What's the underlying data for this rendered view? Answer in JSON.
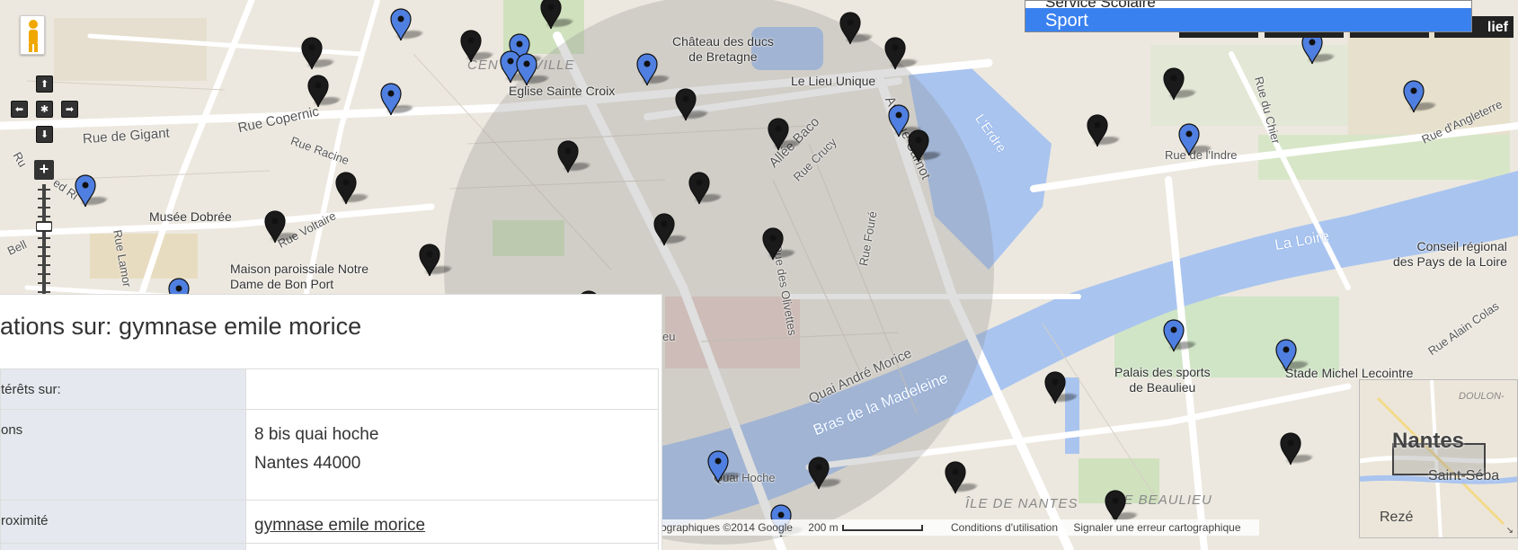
{
  "map": {
    "places": [
      {
        "id": "chateau",
        "text": "Château des ducs\nde Bretagne"
      },
      {
        "id": "lieu-unique",
        "text": "Le Lieu Unique"
      },
      {
        "id": "eglise",
        "text": "Eglise Sainte Croix"
      },
      {
        "id": "musee",
        "text": "Musée Dobrée"
      },
      {
        "id": "maison",
        "text": "Maison paroissiale Notre\nDame de Bon Port"
      },
      {
        "id": "palais",
        "text": "Palais des sports\nde Beaulieu"
      },
      {
        "id": "stade",
        "text": "Stade Michel Lecointre"
      },
      {
        "id": "conseil",
        "text": "Conseil régional\ndes Pays de la Loire"
      }
    ],
    "streets": {
      "gigant": "Rue de Gigant",
      "copernic": "Rue Copernic",
      "racine": "Rue Racine",
      "voltaire": "Rue Voltaire",
      "lamoriciere": "Rue Lamor",
      "bell": "Bell",
      "allee_baco": "Allée Baco",
      "rue_crucy": "Rue Crucy",
      "avenue_carnot": "Avenue Carnot",
      "rue_foure": "Rue Fouré",
      "olivettes": "Rue des Olivettes",
      "quai_andre_morice": "Quai André Morice",
      "quai_hoche": "Quai Hoche",
      "rue_indre": "Rue de l'Indre",
      "rue_chier": "Rue du Chier",
      "rue_angleterre": "Rue d'Angleterre",
      "rue_alain_colas": "Rue Alain Colas",
      "ru": "Ru",
      "ed_ri": "ed Ri",
      "eu": "eu"
    },
    "water": {
      "erdre": "L'Erdre",
      "loire": "La Loire",
      "madeleine": "Bras de la Madeleine"
    },
    "districts": {
      "centre": "CENTRE-VILLE",
      "ile_nantes": "ÎLE DE NANTES",
      "ile_beaulieu": "ILE BEAULIEU"
    },
    "controls": {
      "pan_up": "⬆",
      "pan_left": "⬅",
      "pan_center": "✱",
      "pan_right": "➡",
      "pan_down": "⬇",
      "zoom_in": "+"
    },
    "marker_colors": {
      "blue": "#4f7fe0",
      "black": "#1a1a1a"
    }
  },
  "layer_menu": {
    "previous_option": "Service Scolaire",
    "selected_option": "Sport"
  },
  "maptype_buttons": [
    "",
    "",
    "",
    "lief"
  ],
  "overview": {
    "city": "Nantes",
    "nearby": "Saint-Séba",
    "south": "Rezé",
    "road": "DOULON-",
    "corner": "↘"
  },
  "attribution": {
    "data": "ographiques ©2014 Google",
    "scale": "200 m",
    "terms": "Conditions d'utilisation",
    "report": "Signaler une erreur cartographique"
  },
  "info": {
    "title": "ations sur: gymnase emile morice",
    "rows": [
      {
        "key": "térêts sur:",
        "value": ""
      },
      {
        "key": "ons",
        "address_line1": "8 bis quai hoche",
        "address_line2": "Nantes 44000"
      },
      {
        "key": "roximité",
        "link": "gymnase emile morice"
      }
    ]
  }
}
